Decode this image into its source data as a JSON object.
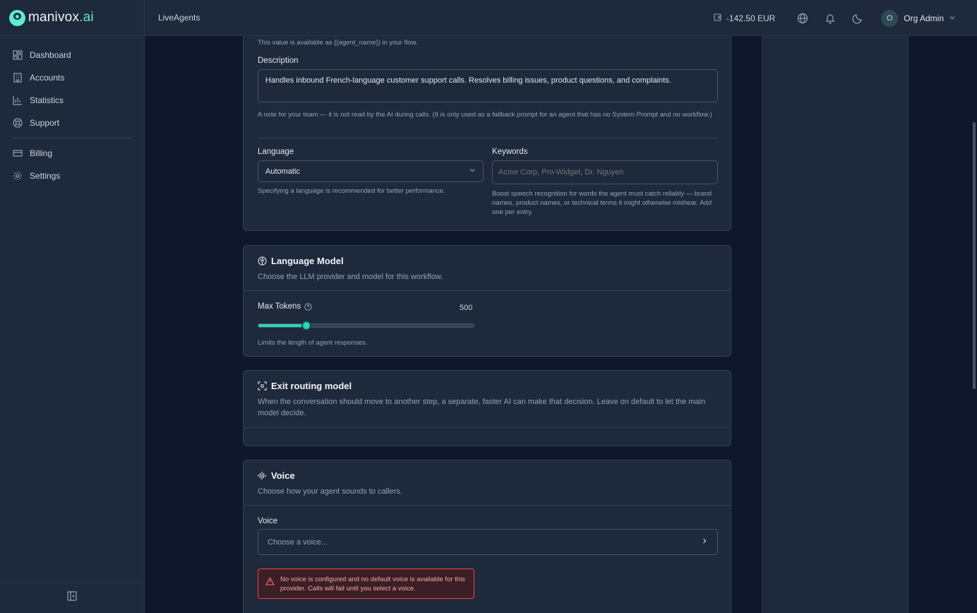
{
  "brand": {
    "name": "manivox",
    "suffix": ".ai"
  },
  "sidebar": {
    "items": [
      {
        "label": "Dashboard",
        "icon": "dashboard-icon"
      },
      {
        "label": "Accounts",
        "icon": "building-icon"
      },
      {
        "label": "Statistics",
        "icon": "bar-chart-icon"
      },
      {
        "label": "Support",
        "icon": "lifebuoy-icon"
      },
      {
        "label": "Billing",
        "icon": "credit-card-icon"
      },
      {
        "label": "Settings",
        "icon": "gear-icon"
      }
    ],
    "collapse_icon": "sidebar-collapse-icon"
  },
  "header": {
    "breadcrumb": "LiveAgents",
    "balance": "-142.50 EUR",
    "user": {
      "initial": "O",
      "name": "Org Admin"
    }
  },
  "general": {
    "name_hint": "This value is available as {{agent_name}} in your flow.",
    "description_label": "Description",
    "description_value": "Handles inbound French-language customer support calls. Resolves billing issues, product questions, and complaints.",
    "description_hint": "A note for your team — it is not read by the AI during calls. (It is only used as a fallback prompt for an agent that has no System Prompt and no workflow.)",
    "language_label": "Language",
    "language_value": "Automatic",
    "language_hint": "Specifying a language is recommended for better performance.",
    "keywords_label": "Keywords",
    "keywords_placeholder": "Acme Corp, Pro-Widget, Dr. Nguyen",
    "keywords_hint": "Boost speech recognition for words the agent must catch reliably — brand names, product names, or technical terms it might otherwise mishear. Add one per entry."
  },
  "llm": {
    "title": "Language Model",
    "subtitle": "Choose the LLM provider and model for this workflow.",
    "max_tokens_label": "Max Tokens",
    "max_tokens_value": "500",
    "slider_fraction": 0.22,
    "max_tokens_hint": "Limits the length of agent responses."
  },
  "routing": {
    "title": "Exit routing model",
    "subtitle": "When the conversation should move to another step, a separate, faster AI can make that decision. Leave on default to let the main model decide."
  },
  "voice": {
    "title": "Voice",
    "subtitle": "Choose how your agent sounds to callers.",
    "voice_label": "Voice",
    "voice_placeholder": "Choose a voice...",
    "alert": "No voice is configured and no default voice is available for this provider. Calls will fail until you select a voice."
  },
  "colors": {
    "accent": "#2dd4bf",
    "background": "#0f172a",
    "surface": "#1e293b",
    "error": "#ef4444"
  }
}
